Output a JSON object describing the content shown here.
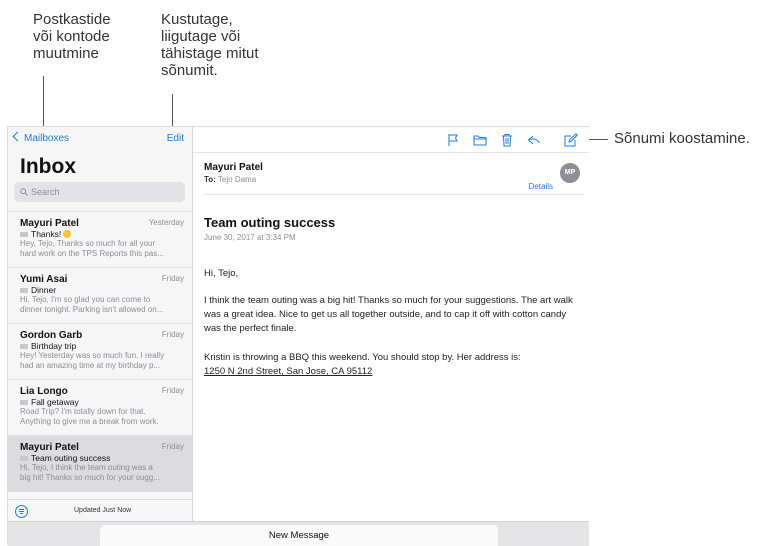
{
  "callouts": {
    "mailboxes": [
      "Postkastide",
      "või kontode",
      "muutmine"
    ],
    "edit": [
      "Kustutage,",
      "liigutage või",
      "tähistage mitut",
      "sõnumit."
    ],
    "compose": "Sõnumi koostamine."
  },
  "sidebar": {
    "back_label": "Mailboxes",
    "edit_label": "Edit",
    "title": "Inbox",
    "search_placeholder": "Search",
    "messages": [
      {
        "from": "Mayuri Patel",
        "date": "Yesterday",
        "subject": "Thanks!",
        "preview1": "Hey, Tejo, Thanks so much for all your",
        "preview2": "hard work on the TPS Reports this pas..."
      },
      {
        "from": "Yumi Asai",
        "date": "Friday",
        "subject": "Dinner",
        "preview1": "Hi, Tejo, I'm so glad you can come to",
        "preview2": "dinner tonight. Parking isn't allowed on..."
      },
      {
        "from": "Gordon Garb",
        "date": "Friday",
        "subject": "Birthday trip",
        "preview1": "Hey! Yesterday was so much fun. I really",
        "preview2": "had an amazing time at my birthday p..."
      },
      {
        "from": "Lia Longo",
        "date": "Friday",
        "subject": "Fall getaway",
        "preview1": "Road Trip? I'm totally down for that.",
        "preview2": "Anything to give me a break from work."
      },
      {
        "from": "Mayuri Patel",
        "date": "Friday",
        "subject": "Team outing success",
        "preview1": "Hi, Tejo, I think the team outing was a",
        "preview2": "big hit! Thanks so much for your sugg..."
      }
    ],
    "status": "Updated Just Now"
  },
  "email": {
    "sender": "Mayuri Patel",
    "to_label": "To:",
    "to_name": "Tejo Dama",
    "details_label": "Details",
    "avatar_initials": "MP",
    "subject": "Team outing success",
    "date": "June 30, 2017 at 3:34 PM",
    "greeting": "Hi, Tejo,",
    "para1": "I think the team outing was a big hit! Thanks so much for your suggestions. The art walk was a great idea. Nice to get us all together outside, and to cap it off with cotton candy was the perfect finale.",
    "para2": "Kristin is throwing a BBQ this weekend. You should stop by. Her address is:",
    "address": "1250 N 2nd Street, San Jose, CA 95112"
  },
  "bottom": {
    "new_message_label": "New Message"
  },
  "toolbar_icons": [
    "flag-icon",
    "folder-icon",
    "trash-icon",
    "reply-icon",
    "compose-icon"
  ],
  "colors": {
    "accent": "#1a7ce8",
    "selected_row": "#dcdce0"
  }
}
